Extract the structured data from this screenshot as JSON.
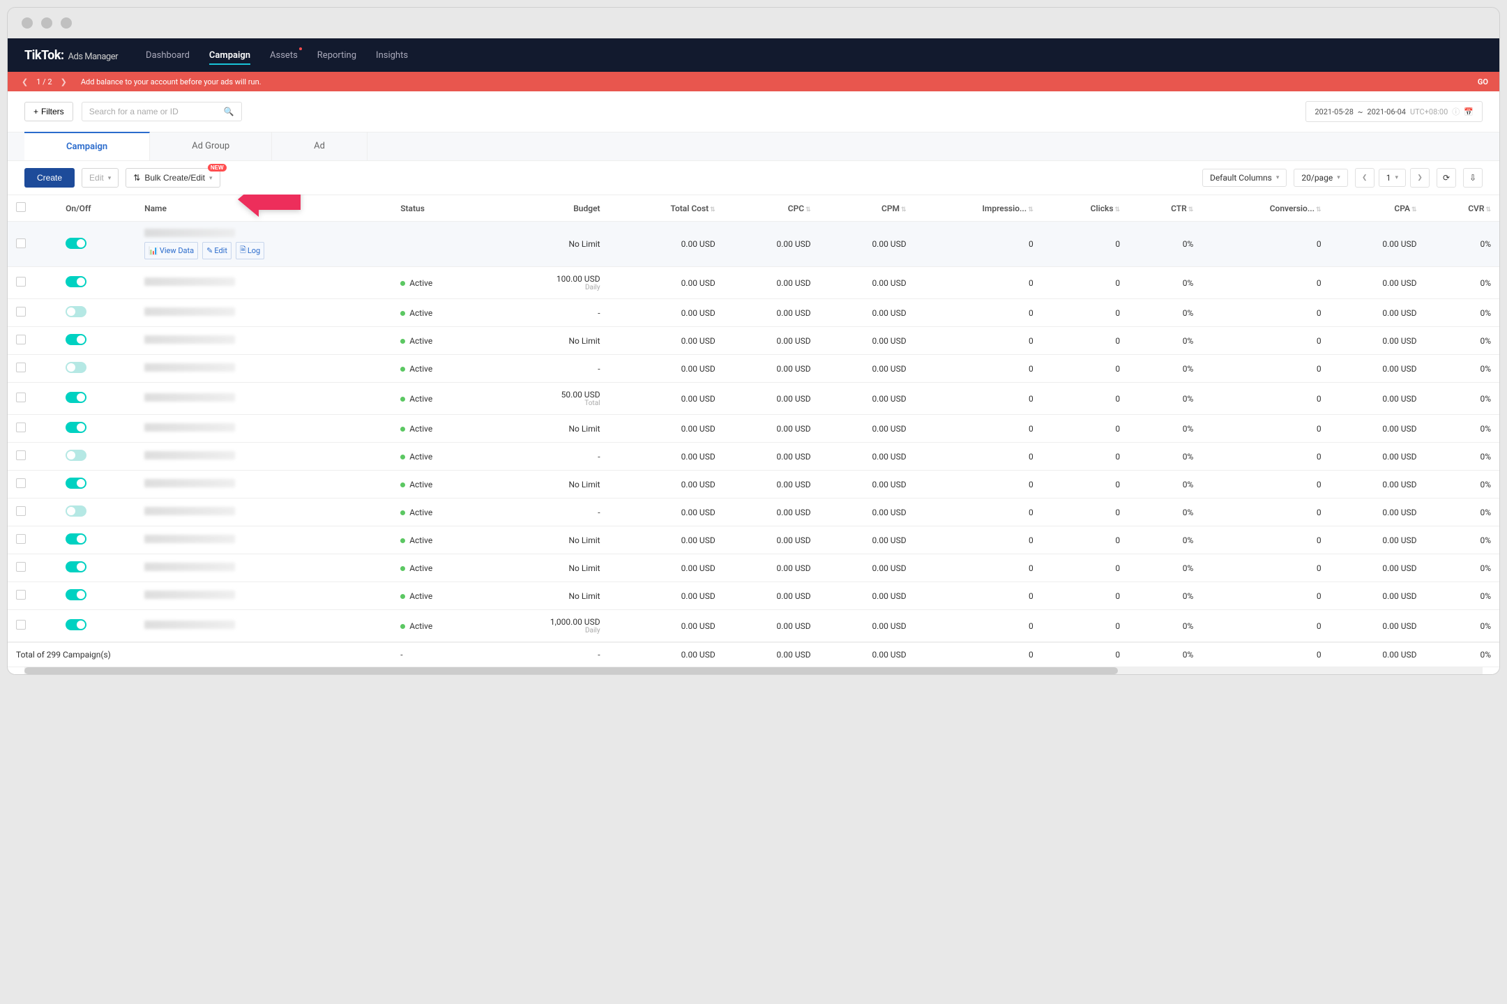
{
  "brand": {
    "name": "TikTok",
    "sub": "Ads Manager"
  },
  "nav": [
    "Dashboard",
    "Campaign",
    "Assets",
    "Reporting",
    "Insights"
  ],
  "nav_active": 1,
  "nav_dot": 2,
  "alert": {
    "pos": "1",
    "total": "2",
    "msg": "Add balance to your account before your ads will run.",
    "go": "GO"
  },
  "filters_btn": "Filters",
  "search_placeholder": "Search for a name or ID",
  "date": {
    "from": "2021-05-28",
    "to": "2021-06-04",
    "tz": "UTC+08:00"
  },
  "tabs": [
    "Campaign",
    "Ad Group",
    "Ad"
  ],
  "tab_active": 0,
  "actions": {
    "create": "Create",
    "edit": "Edit",
    "bulk": "Bulk Create/Edit",
    "badge": "NEW"
  },
  "cols_select": "Default Columns",
  "page_size": "20/page",
  "page_num": "1",
  "columns": [
    "",
    "On/Off",
    "Name",
    "Status",
    "Budget",
    "Total Cost",
    "CPC",
    "CPM",
    "Impressio...",
    "Clicks",
    "CTR",
    "Conversio...",
    "CPA",
    "CVR"
  ],
  "row_actions": {
    "view": "View Data",
    "edit": "Edit",
    "log": "Log"
  },
  "rows": [
    {
      "on": true,
      "hover": true,
      "status": "",
      "budget": "No Limit",
      "budget_sub": "",
      "cost": "0.00 USD",
      "cpc": "0.00 USD",
      "cpm": "0.00 USD",
      "impr": "0",
      "clicks": "0",
      "ctr": "0%",
      "conv": "0",
      "cpa": "0.00 USD",
      "cvr": "0%"
    },
    {
      "on": true,
      "status": "Active",
      "budget": "100.00 USD",
      "budget_sub": "Daily",
      "cost": "0.00 USD",
      "cpc": "0.00 USD",
      "cpm": "0.00 USD",
      "impr": "0",
      "clicks": "0",
      "ctr": "0%",
      "conv": "0",
      "cpa": "0.00 USD",
      "cvr": "0%"
    },
    {
      "on": false,
      "status": "Active",
      "budget": "-",
      "budget_sub": "",
      "cost": "0.00 USD",
      "cpc": "0.00 USD",
      "cpm": "0.00 USD",
      "impr": "0",
      "clicks": "0",
      "ctr": "0%",
      "conv": "0",
      "cpa": "0.00 USD",
      "cvr": "0%"
    },
    {
      "on": true,
      "status": "Active",
      "budget": "No Limit",
      "budget_sub": "",
      "cost": "0.00 USD",
      "cpc": "0.00 USD",
      "cpm": "0.00 USD",
      "impr": "0",
      "clicks": "0",
      "ctr": "0%",
      "conv": "0",
      "cpa": "0.00 USD",
      "cvr": "0%"
    },
    {
      "on": false,
      "status": "Active",
      "budget": "-",
      "budget_sub": "",
      "cost": "0.00 USD",
      "cpc": "0.00 USD",
      "cpm": "0.00 USD",
      "impr": "0",
      "clicks": "0",
      "ctr": "0%",
      "conv": "0",
      "cpa": "0.00 USD",
      "cvr": "0%"
    },
    {
      "on": true,
      "status": "Active",
      "budget": "50.00 USD",
      "budget_sub": "Total",
      "cost": "0.00 USD",
      "cpc": "0.00 USD",
      "cpm": "0.00 USD",
      "impr": "0",
      "clicks": "0",
      "ctr": "0%",
      "conv": "0",
      "cpa": "0.00 USD",
      "cvr": "0%"
    },
    {
      "on": true,
      "status": "Active",
      "budget": "No Limit",
      "budget_sub": "",
      "cost": "0.00 USD",
      "cpc": "0.00 USD",
      "cpm": "0.00 USD",
      "impr": "0",
      "clicks": "0",
      "ctr": "0%",
      "conv": "0",
      "cpa": "0.00 USD",
      "cvr": "0%"
    },
    {
      "on": false,
      "status": "Active",
      "budget": "-",
      "budget_sub": "",
      "cost": "0.00 USD",
      "cpc": "0.00 USD",
      "cpm": "0.00 USD",
      "impr": "0",
      "clicks": "0",
      "ctr": "0%",
      "conv": "0",
      "cpa": "0.00 USD",
      "cvr": "0%"
    },
    {
      "on": true,
      "status": "Active",
      "budget": "No Limit",
      "budget_sub": "",
      "cost": "0.00 USD",
      "cpc": "0.00 USD",
      "cpm": "0.00 USD",
      "impr": "0",
      "clicks": "0",
      "ctr": "0%",
      "conv": "0",
      "cpa": "0.00 USD",
      "cvr": "0%"
    },
    {
      "on": false,
      "status": "Active",
      "budget": "-",
      "budget_sub": "",
      "cost": "0.00 USD",
      "cpc": "0.00 USD",
      "cpm": "0.00 USD",
      "impr": "0",
      "clicks": "0",
      "ctr": "0%",
      "conv": "0",
      "cpa": "0.00 USD",
      "cvr": "0%"
    },
    {
      "on": true,
      "status": "Active",
      "budget": "No Limit",
      "budget_sub": "",
      "cost": "0.00 USD",
      "cpc": "0.00 USD",
      "cpm": "0.00 USD",
      "impr": "0",
      "clicks": "0",
      "ctr": "0%",
      "conv": "0",
      "cpa": "0.00 USD",
      "cvr": "0%"
    },
    {
      "on": true,
      "status": "Active",
      "budget": "No Limit",
      "budget_sub": "",
      "cost": "0.00 USD",
      "cpc": "0.00 USD",
      "cpm": "0.00 USD",
      "impr": "0",
      "clicks": "0",
      "ctr": "0%",
      "conv": "0",
      "cpa": "0.00 USD",
      "cvr": "0%"
    },
    {
      "on": true,
      "status": "Active",
      "budget": "No Limit",
      "budget_sub": "",
      "cost": "0.00 USD",
      "cpc": "0.00 USD",
      "cpm": "0.00 USD",
      "impr": "0",
      "clicks": "0",
      "ctr": "0%",
      "conv": "0",
      "cpa": "0.00 USD",
      "cvr": "0%"
    },
    {
      "on": true,
      "status": "Active",
      "budget": "1,000.00 USD",
      "budget_sub": "Daily",
      "cost": "0.00 USD",
      "cpc": "0.00 USD",
      "cpm": "0.00 USD",
      "impr": "0",
      "clicks": "0",
      "ctr": "0%",
      "conv": "0",
      "cpa": "0.00 USD",
      "cvr": "0%"
    }
  ],
  "footer": {
    "label": "Total of 299 Campaign(s)",
    "status": "-",
    "budget": "-",
    "cost": "0.00 USD",
    "cpc": "0.00 USD",
    "cpm": "0.00 USD",
    "impr": "0",
    "clicks": "0",
    "ctr": "0%",
    "conv": "0",
    "cpa": "0.00 USD",
    "cvr": "0%"
  }
}
